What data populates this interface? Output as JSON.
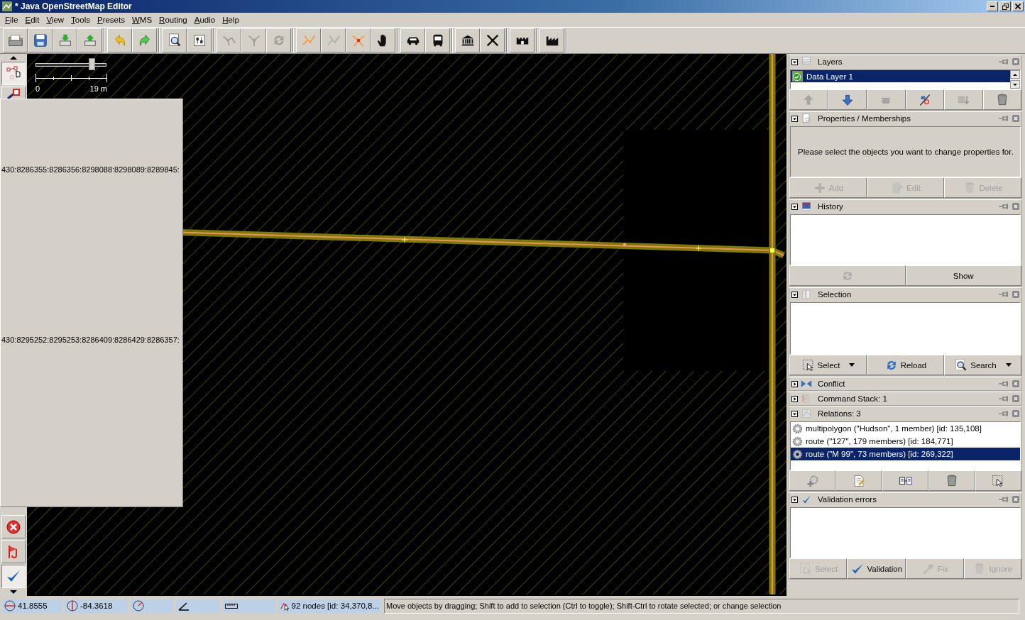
{
  "window": {
    "title": "* Java OpenStreetMap Editor"
  },
  "menu": [
    "File",
    "Edit",
    "View",
    "Tools",
    "Presets",
    "WMS",
    "Routing",
    "Audio",
    "Help"
  ],
  "toolbar": [
    [
      {
        "disabled": false
      },
      {
        "disabled": false
      },
      {
        "disabled": false
      },
      {
        "disabled": false
      }
    ],
    [
      {
        "disabled": false
      },
      {
        "disabled": false
      }
    ],
    [
      {
        "disabled": false
      },
      {
        "disabled": false
      }
    ],
    [
      {
        "disabled": true
      },
      {
        "disabled": true
      },
      {
        "disabled": true
      }
    ],
    [
      {
        "disabled": false
      },
      {
        "disabled": true
      },
      {
        "disabled": false
      },
      {
        "disabled": false
      }
    ],
    [
      {
        "disabled": false
      },
      {
        "disabled": false
      }
    ],
    [
      {
        "disabled": false
      },
      {
        "disabled": false
      }
    ],
    [
      {
        "disabled": false
      }
    ],
    [
      {
        "disabled": false
      }
    ]
  ],
  "toolbox": [
    {
      "selected": true
    },
    {
      "selected": false
    },
    {
      "selected": false
    },
    {
      "selected": false
    },
    {
      "selected": true
    }
  ],
  "map": {
    "zoom_slider": {
      "level": 0.8
    },
    "scale": {
      "start": "0",
      "end": "19 m"
    },
    "overlay_lines": [
      "430:8286355:8286356:8298088:8298089:8289845:",
      "430:8295252:8295253:8286409:8286429:8286357:"
    ]
  },
  "dialogs": [
    {
      "kind": "layers",
      "title": "Layers",
      "expanded": true,
      "items": [
        {
          "label": "Data Layer 1",
          "selected": true
        }
      ],
      "buttons": [
        {
          "disabled": true
        },
        {
          "disabled": false
        },
        {
          "disabled": true
        },
        {
          "disabled": false
        },
        {
          "disabled": true
        },
        {
          "disabled": false
        }
      ]
    },
    {
      "kind": "properties",
      "title": "Properties / Memberships",
      "expanded": true,
      "message": "Please select the objects you want to change properties for.",
      "buttons": [
        {
          "label": "Add",
          "disabled": true
        },
        {
          "label": "Edit",
          "disabled": true
        },
        {
          "label": "Delete",
          "disabled": true
        }
      ]
    },
    {
      "kind": "history",
      "title": "History",
      "expanded": true,
      "buttons": [
        {
          "disabled": true
        },
        {
          "label": "Show",
          "disabled": false
        }
      ]
    },
    {
      "kind": "selection",
      "title": "Selection",
      "expanded": true,
      "buttons": [
        {
          "label": "Select",
          "disabled": false,
          "dropdown": true
        },
        {
          "label": "Reload",
          "disabled": false
        },
        {
          "label": "Search",
          "disabled": false,
          "dropdown": true
        }
      ]
    },
    {
      "kind": "conflict",
      "title": "Conflict",
      "expanded": false
    },
    {
      "kind": "commands",
      "title": "Command Stack: 1",
      "expanded": false
    },
    {
      "kind": "relations",
      "title": "Relations: 3",
      "expanded": true,
      "items": [
        {
          "label": "multipolygon (\"Hudson\", 1 member) [id: 135,108]",
          "selected": false
        },
        {
          "label": "route (\"127\", 179 members) [id: 184,771]",
          "selected": false
        },
        {
          "label": "route (\"M 99\", 73 members) [id: 269,322]",
          "selected": true
        }
      ],
      "buttons": [
        {
          "disabled": false
        },
        {
          "disabled": false
        },
        {
          "disabled": false
        },
        {
          "disabled": false
        },
        {
          "disabled": false
        }
      ]
    },
    {
      "kind": "validation",
      "title": "Validation errors",
      "expanded": true,
      "buttons": [
        {
          "label": "Select",
          "disabled": true
        },
        {
          "label": "Validation",
          "disabled": false
        },
        {
          "label": "Fix",
          "disabled": true
        },
        {
          "label": "Ignore",
          "disabled": true
        }
      ]
    }
  ],
  "status_bar": {
    "latitude": "41.8555",
    "longitude": "-84.3618",
    "nodes": "92 nodes [id: 34,370,8...",
    "message": "Move objects by dragging; Shift to add to selection (Ctrl to toggle); Shift-Ctrl to rotate selected; or change selection"
  }
}
